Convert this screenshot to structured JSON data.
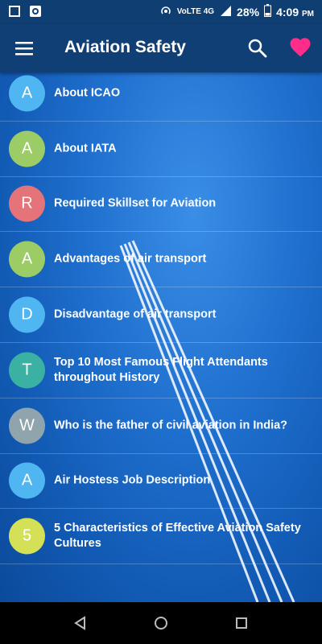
{
  "status_bar": {
    "network": "VoLTE 4G",
    "network_sup": "4G",
    "battery": "28%",
    "time": "4:09",
    "ampm": "PM"
  },
  "app_bar": {
    "title": "Aviation Safety",
    "menu_icon": "hamburger-menu-icon",
    "search_icon": "search-icon",
    "favorite_icon": "heart-icon",
    "favorite_color": "#ff2d8a"
  },
  "items": [
    {
      "letter": "A",
      "label": "About ICAO",
      "color": "#4fb6f2"
    },
    {
      "letter": "A",
      "label": "About IATA",
      "color": "#9ccc65"
    },
    {
      "letter": "R",
      "label": "Required Skillset for Aviation",
      "color": "#e5737a"
    },
    {
      "letter": "A",
      "label": "Advantages of air transport",
      "color": "#9ccc65"
    },
    {
      "letter": "D",
      "label": "Disadvantage of air transport",
      "color": "#4fb6f2"
    },
    {
      "letter": "T",
      "label": "Top 10 Most Famous Flight Attendants throughout History",
      "color": "#3bb1a4"
    },
    {
      "letter": "W",
      "label": "Who is the father of civil aviation in India?",
      "color": "#90a4ae"
    },
    {
      "letter": "A",
      "label": "Air Hostess Job Description",
      "color": "#4fb6f2"
    },
    {
      "letter": "5",
      "label": "5 Characteristics of Effective Aviation Safety Cultures",
      "color": "#d4e157"
    }
  ],
  "nav_bar": {
    "back_icon": "back-triangle-icon",
    "home_icon": "home-circle-icon",
    "recents_icon": "recents-square-icon"
  }
}
